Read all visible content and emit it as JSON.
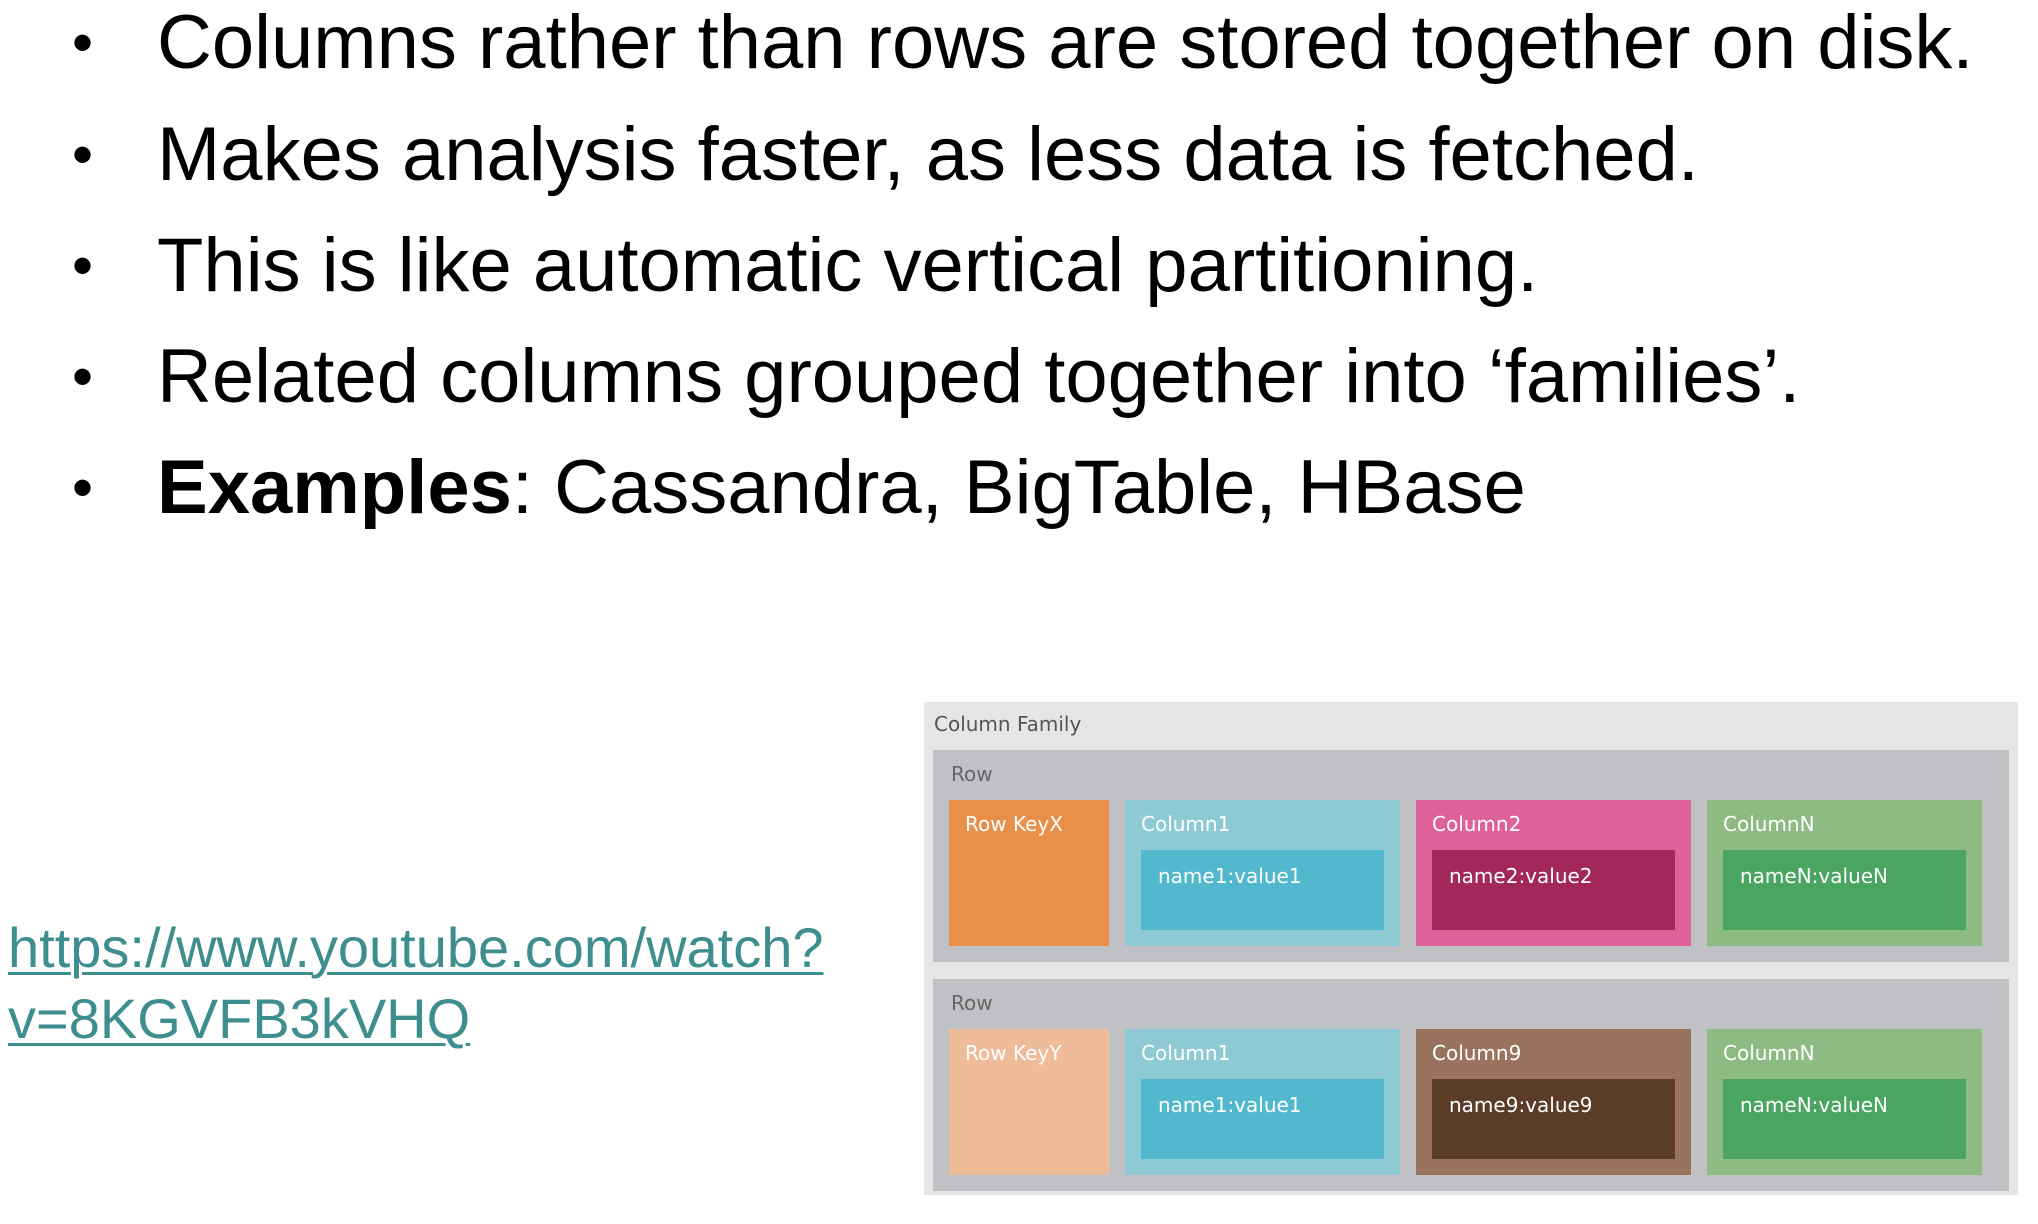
{
  "bullets": [
    {
      "text": "Columns rather than rows are stored together on disk."
    },
    {
      "text": "Makes analysis faster, as less data is fetched."
    },
    {
      "text": "This is like automatic vertical partitioning."
    },
    {
      "text": "Related columns grouped together into ‘families’."
    },
    {
      "bold": "Examples",
      "text": ": Cassandra, BigTable, HBase"
    }
  ],
  "bullet_glyph": "•",
  "link": {
    "line1": "https://www.youtube.com/watch?",
    "line2": "v=8KGVFB3kVHQ",
    "color": "#3d8e8c"
  },
  "diagram": {
    "label": "Column Family",
    "rows": [
      {
        "label": "Row",
        "key": {
          "title": "Row KeyX",
          "color": "#e8904a"
        },
        "columns": [
          {
            "title": "Column1",
            "value": "name1:value1",
            "color": "#8ecad4",
            "inner_color": "#52b8cd"
          },
          {
            "title": "Column2",
            "value": "name2:value2",
            "color": "#de619a",
            "inner_color": "#a3285a"
          },
          {
            "title": "ColumnN",
            "value": "nameN:valueN",
            "color": "#8eba84",
            "inner_color": "#4aa561"
          }
        ]
      },
      {
        "label": "Row",
        "key": {
          "title": "Row KeyY",
          "color": "#eebc98"
        },
        "columns": [
          {
            "title": "Column1",
            "value": "name1:value1",
            "color": "#8ecad4",
            "inner_color": "#52b8cd"
          },
          {
            "title": "Column9",
            "value": "name9:value9",
            "color": "#9a735e",
            "inner_color": "#5b3d27"
          },
          {
            "title": "ColumnN",
            "value": "nameN:valueN",
            "color": "#8eba84",
            "inner_color": "#4aa561"
          }
        ]
      }
    ]
  }
}
